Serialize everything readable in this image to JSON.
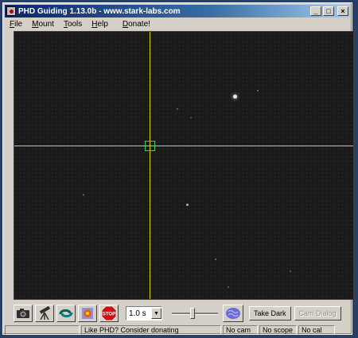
{
  "window": {
    "title": "PHD Guiding 1.13.0b  -  www.stark-labs.com",
    "controls": [
      "_",
      "□",
      "×"
    ]
  },
  "menu": [
    {
      "key": "F",
      "rest": "ile"
    },
    {
      "key": "M",
      "rest": "ount"
    },
    {
      "key": "T",
      "rest": "ools"
    },
    {
      "key": "H",
      "rest": "elp"
    },
    {
      "key": "D",
      "rest": "onate!"
    }
  ],
  "toolbar": {
    "buttons": [
      "camera-icon",
      "telescope-icon",
      "loop-icon",
      "guide-icon",
      "stop-icon"
    ],
    "stop_label": "STOP",
    "exposure": "1.0 s",
    "gamma_level": 0.45,
    "take_dark": "Take Dark",
    "cam_dialog": "Cam Dialog"
  },
  "status": {
    "message": "Like PHD? Consider donating",
    "camera": "No cam",
    "scope": "No scope",
    "cal": "No cal"
  },
  "colors": {
    "crosshair": "#d8d800",
    "lock_box": "#40d040",
    "canvas": "#1a1a1a"
  }
}
